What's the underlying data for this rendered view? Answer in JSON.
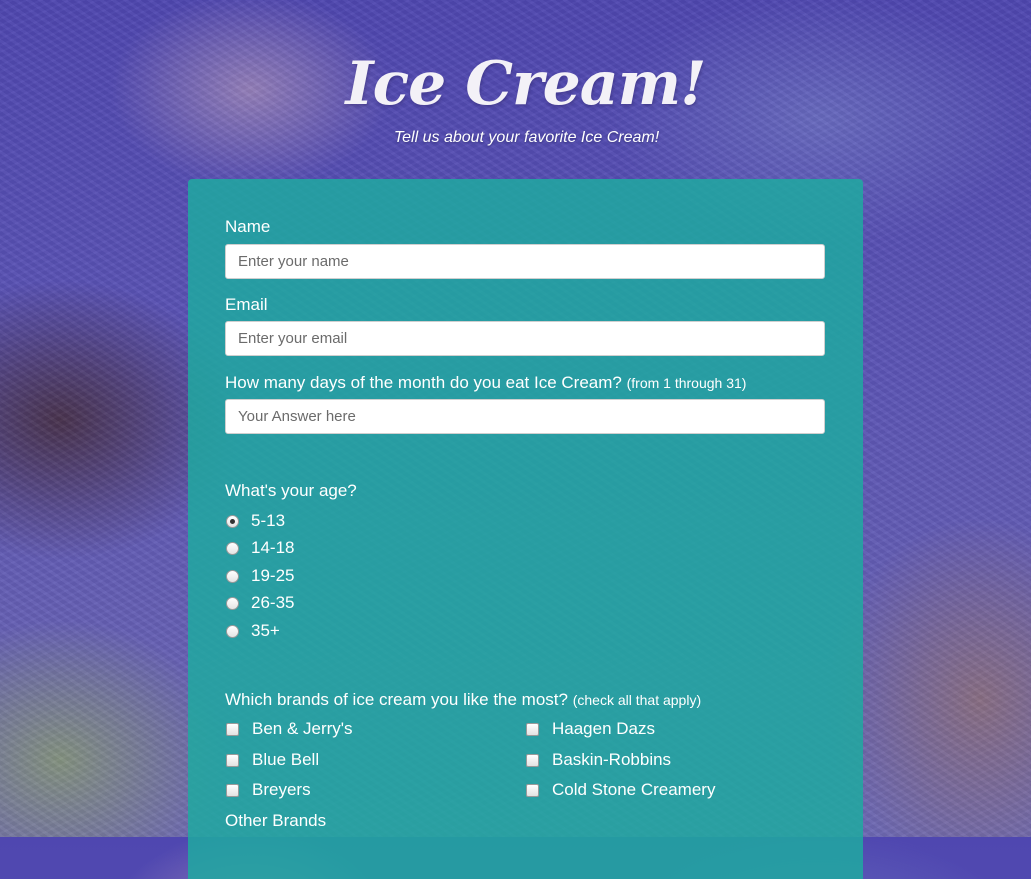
{
  "header": {
    "title": "Ice Cream!",
    "subtitle": "Tell us about your favorite Ice Cream!"
  },
  "form": {
    "name": {
      "label": "Name",
      "placeholder": "Enter your name"
    },
    "email": {
      "label": "Email",
      "placeholder": "Enter your email"
    },
    "days": {
      "label": "How many days of the month do you eat Ice Cream?",
      "clue": "(from 1 through 31)",
      "placeholder": "Your Answer here"
    },
    "age": {
      "label": "What's your age?",
      "selected": "5-13",
      "options": [
        "5-13",
        "14-18",
        "19-25",
        "26-35",
        "35+"
      ]
    },
    "brands": {
      "label": "Which brands of ice cream you like the most?",
      "clue": "(check all that apply)",
      "options": [
        "Ben & Jerry's",
        "Haagen Dazs",
        "Blue Bell",
        "Baskin-Robbins",
        "Breyers",
        "Cold Stone Creamery"
      ]
    },
    "other_brands": {
      "label": "Other Brands"
    }
  }
}
